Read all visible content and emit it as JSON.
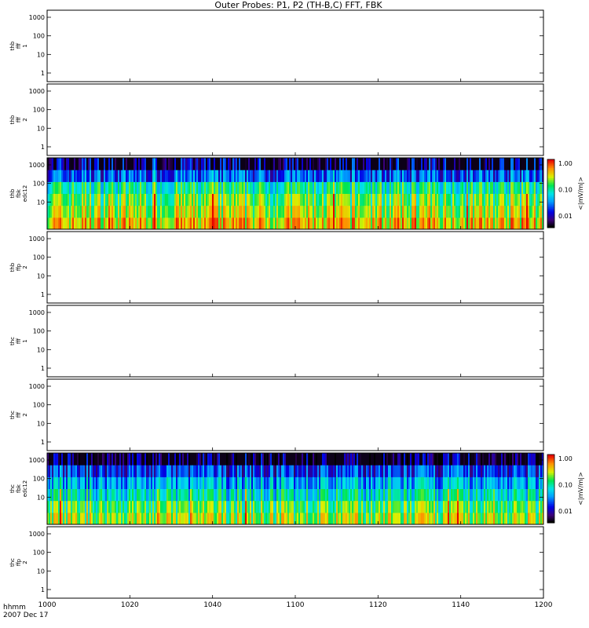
{
  "title": "Outer Probes: P1, P2 (TH-B,C) FFT, FBK",
  "time_label": "hhmm",
  "date_label": "2007 Dec 17",
  "x_ticks": [
    "1000",
    "1020",
    "1040",
    "1100",
    "1120",
    "1140",
    "1200"
  ],
  "chart_data": {
    "type": "heatmap",
    "title": "Outer Probes: P1, P2 (TH-B,C) FFT, FBK",
    "xlabel": "hhmm",
    "x_range": [
      "1000",
      "1200"
    ],
    "x_ticks": [
      "1000",
      "1020",
      "1040",
      "1100",
      "1120",
      "1140",
      "1200"
    ],
    "ylog": true,
    "panels": [
      {
        "label": [
          "thb",
          "fff",
          "1"
        ],
        "y_ticks": [
          "1000",
          "100",
          "10",
          "1"
        ],
        "has_data": false
      },
      {
        "label": [
          "thb",
          "fff",
          "2"
        ],
        "y_ticks": [
          "1000",
          "100",
          "10",
          "1"
        ],
        "has_data": false
      },
      {
        "label": [
          "thb",
          "fbk",
          "edc12"
        ],
        "y_ticks": [
          "1000",
          "100",
          "10"
        ],
        "has_data": true,
        "colorbar": {
          "ticks": [
            "1.00",
            "0.10",
            "0.01"
          ],
          "label": "<|mV/m|>"
        },
        "band_levels": [
          0.18,
          0.3,
          0.55,
          0.65,
          0.72,
          0.8
        ]
      },
      {
        "label": [
          "thb",
          "ffp",
          "2"
        ],
        "y_ticks": [
          "1000",
          "100",
          "10",
          "1"
        ],
        "has_data": false
      },
      {
        "label": [
          "thc",
          "fff",
          "1"
        ],
        "y_ticks": [
          "1000",
          "100",
          "10",
          "1"
        ],
        "has_data": false
      },
      {
        "label": [
          "thc",
          "fff",
          "2"
        ],
        "y_ticks": [
          "1000",
          "100",
          "10",
          "1"
        ],
        "has_data": false
      },
      {
        "label": [
          "thc",
          "fbk",
          "edc12"
        ],
        "y_ticks": [
          "1000",
          "100",
          "10"
        ],
        "has_data": true,
        "colorbar": {
          "ticks": [
            "1.00",
            "0.10",
            "0.01"
          ],
          "label": "<|mV/m|>"
        },
        "band_levels": [
          0.1,
          0.25,
          0.4,
          0.5,
          0.62,
          0.7
        ]
      },
      {
        "label": [
          "thc",
          "ffp",
          "2"
        ],
        "y_ticks": [
          "1000",
          "100",
          "10",
          "1"
        ],
        "has_data": false
      }
    ]
  }
}
